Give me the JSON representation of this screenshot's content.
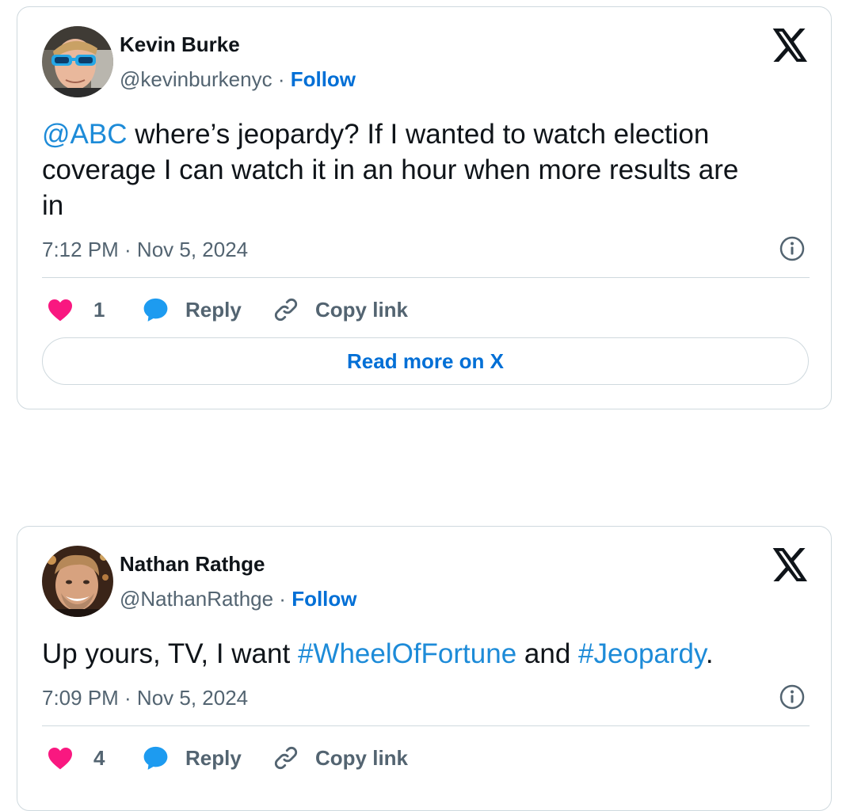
{
  "colors": {
    "link_blue": "#1d8bd8",
    "follow_blue": "#006fd6",
    "heart_pink": "#f91880",
    "reply_blue": "#1d9bf0",
    "muted_gray": "#536471",
    "border_gray": "#cfd9de"
  },
  "tweets": [
    {
      "author_name": "Kevin Burke",
      "handle": "@kevinburkenyc",
      "separator": " · ",
      "follow_label": "Follow",
      "text_parts": {
        "mention": "@ABC",
        "line1_rest": " where’s jeopardy?  If I wanted to watch election",
        "line2": "coverage I can watch it in an hour when more results are",
        "line3": "in"
      },
      "timestamp": "7:12 PM · Nov 5, 2024",
      "like_count": "1",
      "reply_label": "Reply",
      "copy_link_label": "Copy link",
      "read_more_label": "Read more on X",
      "icons": [
        "x-logo-icon",
        "info-icon",
        "heart-icon",
        "reply-bubble-icon",
        "link-icon"
      ]
    },
    {
      "author_name": "Nathan Rathge",
      "handle": "@NathanRathge",
      "separator": " · ",
      "follow_label": "Follow",
      "text_parts": {
        "prefix": "Up yours, TV, I want ",
        "hashtag1": "#WheelOfFortune",
        "middle": " and ",
        "hashtag2": "#Jeopardy",
        "suffix": "."
      },
      "timestamp": "7:09 PM · Nov 5, 2024",
      "like_count": "4",
      "reply_label": "Reply",
      "copy_link_label": "Copy link",
      "icons": [
        "x-logo-icon",
        "info-icon",
        "heart-icon",
        "reply-bubble-icon",
        "link-icon"
      ]
    }
  ]
}
